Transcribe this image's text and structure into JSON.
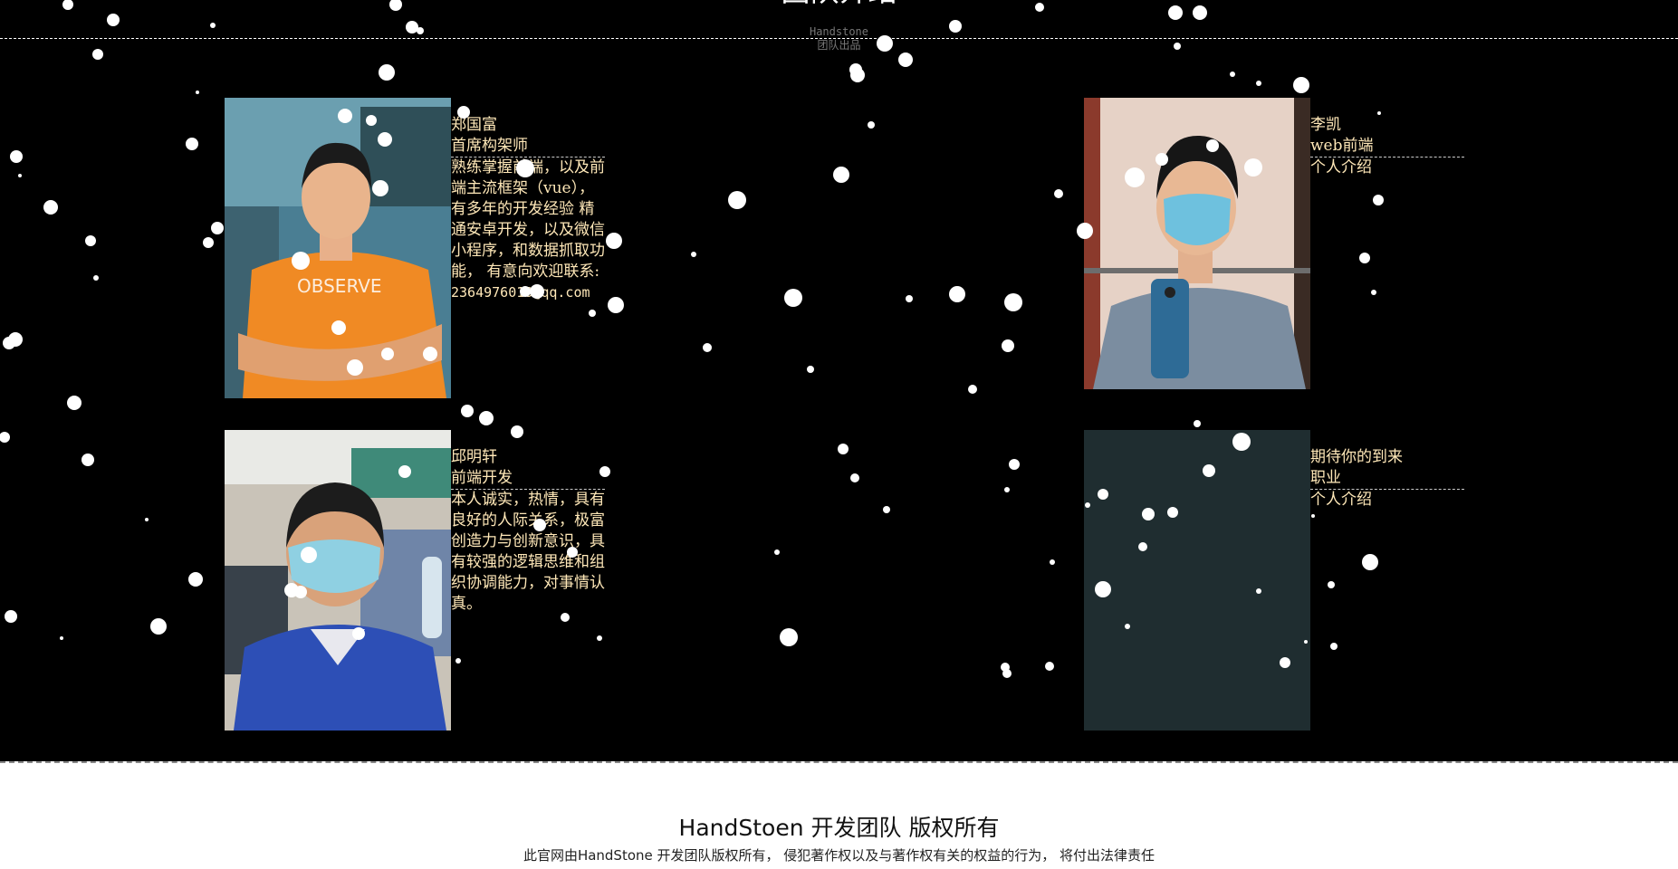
{
  "header": {
    "title": "团队介绍",
    "subtitle_en": "Handstone",
    "subtitle_cn": "团队出品"
  },
  "members": [
    {
      "name": "郑国富",
      "role": "首席构架师",
      "desc": "熟练掌握前端，以及前端主流框架（vue），有多年的开发经验 精通安卓开发，以及微信小程序，和数据抓取功能， 有意向欢迎联系:",
      "email": "2364976018@qq.com"
    },
    {
      "name": "李凯",
      "role": "web前端",
      "desc": "个人介绍"
    },
    {
      "name": "邱明轩",
      "role": "前端开发",
      "desc": "本人诚实，热情，具有良好的人际关系，极富创造力与创新意识，具有较强的逻辑思维和组织协调能力，对事情认真。"
    },
    {
      "name": "期待你的到来",
      "role": "职业",
      "desc": "个人介绍"
    }
  ],
  "footer": {
    "title": "HandStoen 开发团队 版权所有",
    "note": "此官网由HandStone 开发团队版权所有， 侵犯著作权以及与著作权有关的权益的行为， 将付出法律责任"
  },
  "colors": {
    "background": "#000000",
    "info_text": "#ffe8b8",
    "placeholder_photo": "#1f2d30",
    "footer_bg": "#ffffff"
  }
}
